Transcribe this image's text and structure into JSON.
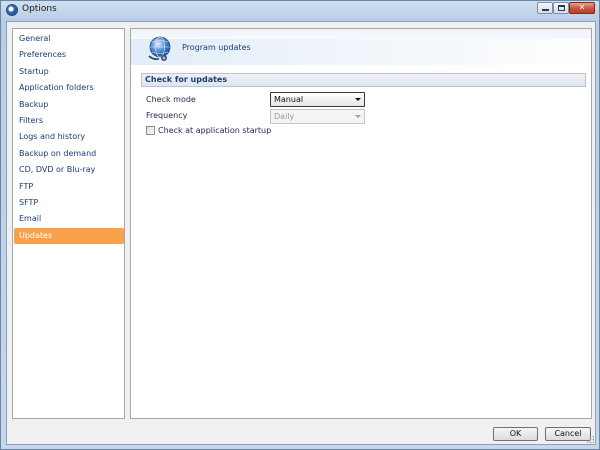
{
  "window": {
    "title": "Options"
  },
  "sidebar": {
    "items": [
      {
        "label": "General",
        "selected": false
      },
      {
        "label": "Preferences",
        "selected": false
      },
      {
        "label": "Startup",
        "selected": false
      },
      {
        "label": "Application folders",
        "selected": false
      },
      {
        "label": "Backup",
        "selected": false
      },
      {
        "label": "Filters",
        "selected": false
      },
      {
        "label": "Logs and history",
        "selected": false
      },
      {
        "label": "Backup on demand",
        "selected": false
      },
      {
        "label": "CD, DVD or Blu-ray",
        "selected": false
      },
      {
        "label": "FTP",
        "selected": false
      },
      {
        "label": "SFTP",
        "selected": false
      },
      {
        "label": "Email",
        "selected": false
      },
      {
        "label": "Updates",
        "selected": true
      }
    ]
  },
  "main": {
    "header_title": "Program updates",
    "header_icon": "globe-update-icon",
    "section_title": "Check for updates",
    "check_mode": {
      "label": "Check mode",
      "value": "Manual"
    },
    "frequency": {
      "label": "Frequency",
      "value": "Daily",
      "enabled": false
    },
    "startup_check": {
      "label": "Check at application startup",
      "checked": false
    }
  },
  "buttons": {
    "ok": "OK",
    "cancel": "Cancel"
  },
  "colors": {
    "selected_item": "#f7a24a",
    "link_text": "#1a3c78"
  }
}
